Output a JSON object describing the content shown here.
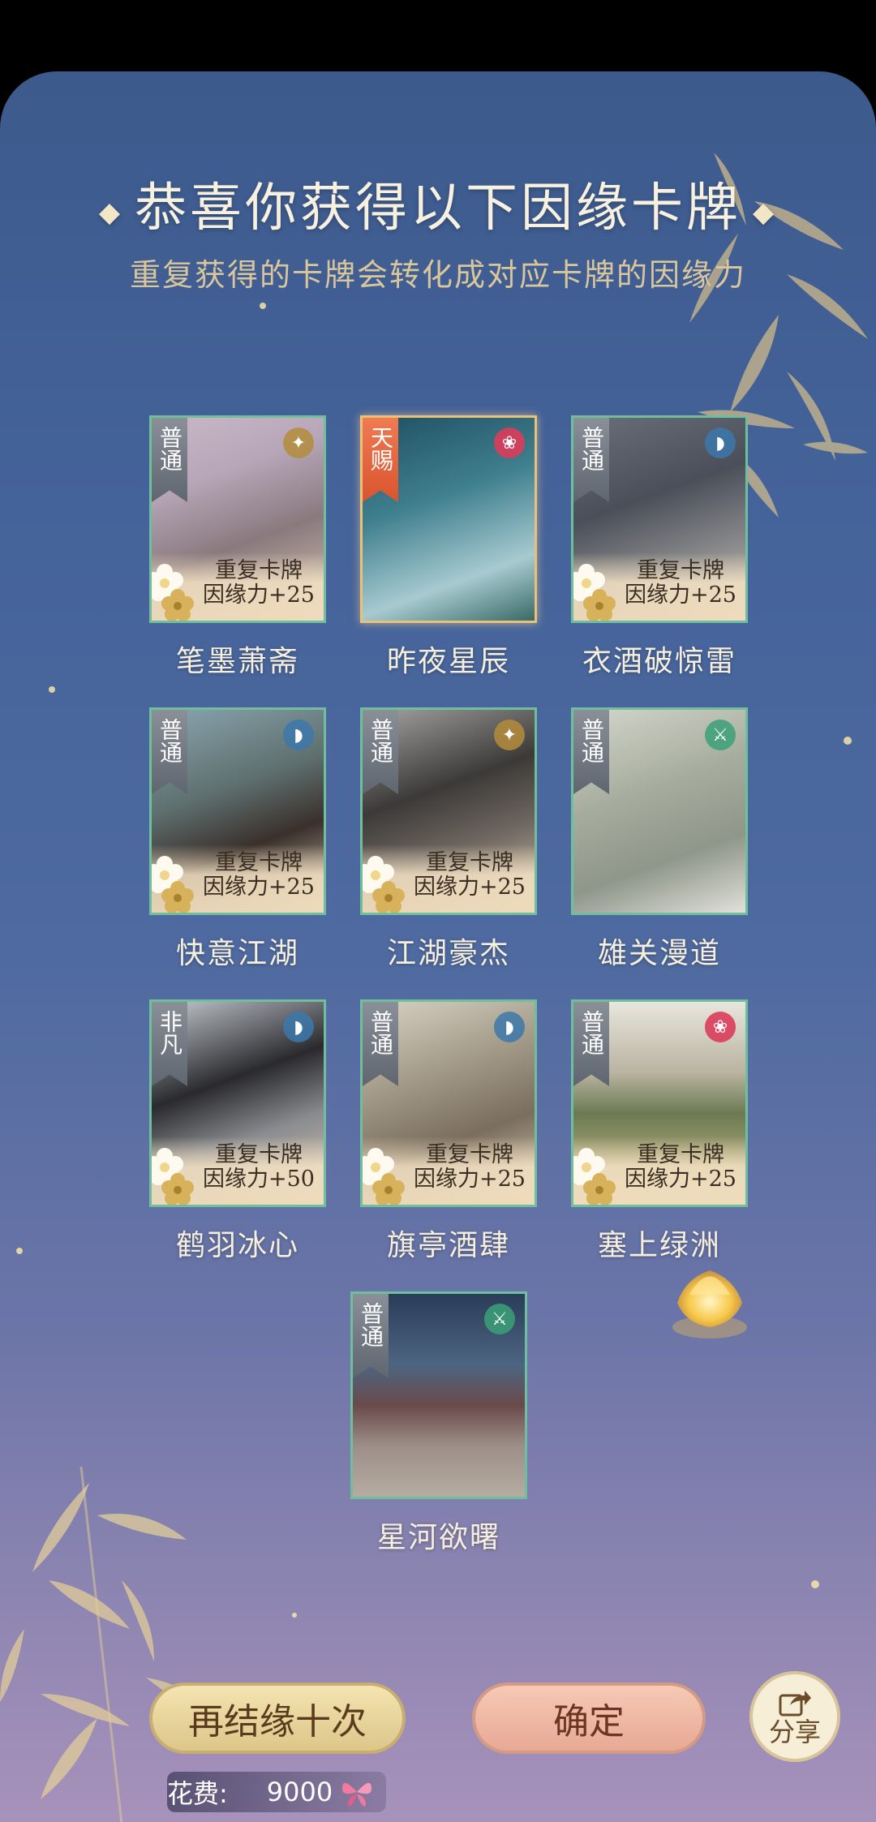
{
  "header": {
    "title": "恭喜你获得以下因缘卡牌",
    "subtitle": "重复获得的卡牌会转化成对应卡牌的因缘力"
  },
  "cards": [
    {
      "name": "笔墨萧斋",
      "rarity": "普通",
      "dup_line1": "重复卡牌",
      "dup_line2": "因缘力+25",
      "icon": "gold-coin-icon"
    },
    {
      "name": "昨夜星辰",
      "rarity": "天赐",
      "dup_line1": "",
      "dup_line2": "",
      "icon": "plum-blossom-icon"
    },
    {
      "name": "衣酒破惊雷",
      "rarity": "普通",
      "dup_line1": "重复卡牌",
      "dup_line2": "因缘力+25",
      "icon": "fan-icon"
    },
    {
      "name": "快意江湖",
      "rarity": "普通",
      "dup_line1": "重复卡牌",
      "dup_line2": "因缘力+25",
      "icon": "fan-icon"
    },
    {
      "name": "江湖豪杰",
      "rarity": "普通",
      "dup_line1": "重复卡牌",
      "dup_line2": "因缘力+25",
      "icon": "gold-coin-icon"
    },
    {
      "name": "雄关漫道",
      "rarity": "普通",
      "dup_line1": "",
      "dup_line2": "",
      "icon": "sword-icon"
    },
    {
      "name": "鹤羽冰心",
      "rarity": "非凡",
      "dup_line1": "重复卡牌",
      "dup_line2": "因缘力+50",
      "icon": "fan-icon"
    },
    {
      "name": "旗亭酒肆",
      "rarity": "普通",
      "dup_line1": "重复卡牌",
      "dup_line2": "因缘力+25",
      "icon": "fan-icon"
    },
    {
      "name": "塞上绿洲",
      "rarity": "普通",
      "dup_line1": "重复卡牌",
      "dup_line2": "因缘力+25",
      "icon": "plum-blossom-icon"
    },
    {
      "name": "星河欲曙",
      "rarity": "普通",
      "dup_line1": "",
      "dup_line2": "",
      "icon": "sword-icon"
    }
  ],
  "buttons": {
    "again": "再结缘十次",
    "confirm": "确定",
    "share": "分享"
  },
  "cost": {
    "label": "花费:",
    "amount": "9000"
  },
  "colors": {
    "card_border": "#6fbf9e",
    "special_border": "#e8c27a",
    "title_text": "#f8f1df",
    "subtitle_text": "#d9c69b"
  }
}
